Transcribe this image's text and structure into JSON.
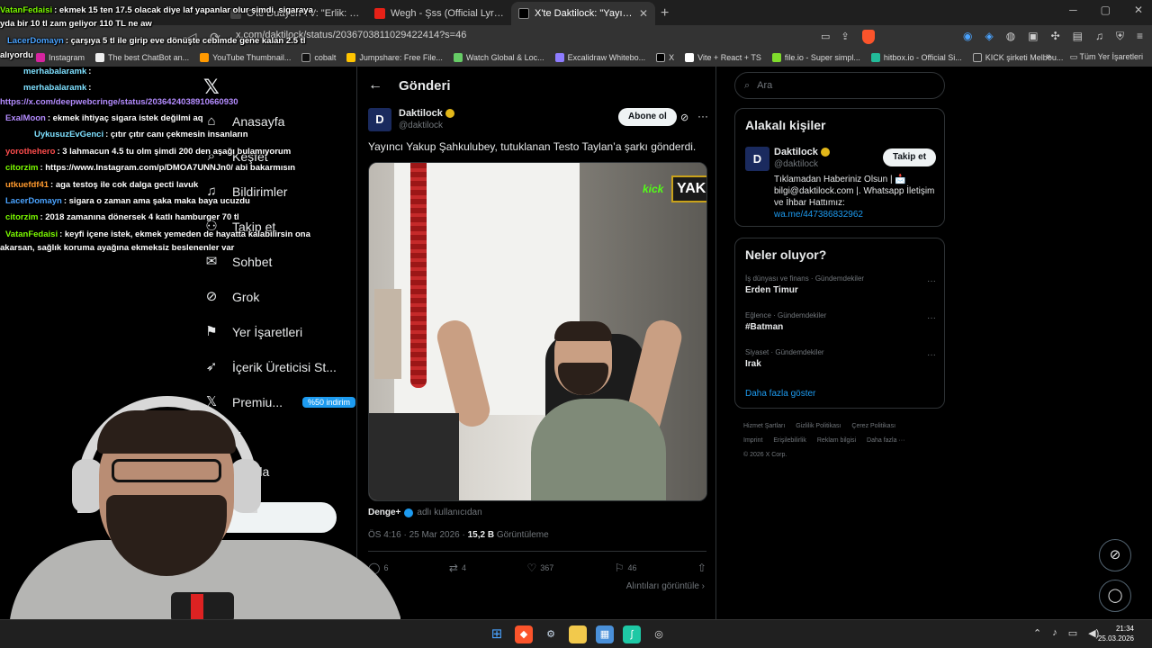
{
  "browser": {
    "tabs": [
      {
        "label": "C'te Duayen TV: \"Erlik: Nevruz'da TÜ",
        "active": false
      },
      {
        "label": "Wegh - Şss (Official Lyric Video) - Yo",
        "active": false
      },
      {
        "label": "X'te Daktilock: \"Yayıncı Yakup",
        "active": true
      }
    ],
    "url": "x.com/daktilock/status/2036703811029422414?s=46",
    "bookmarks": [
      "Instagram",
      "The best ChatBot an...",
      "YouTube Thumbnail...",
      "cobalt",
      "Jumpshare: Free File...",
      "Watch Global & Loc...",
      "Excalidraw Whitebo...",
      "X",
      "Vite + React + TS",
      "file.io - Super simpl...",
      "hitbox.io - Official Si...",
      "KICK şirketi Melbou..."
    ],
    "bookmarks_all": "Tüm Yer İşaretleri"
  },
  "x": {
    "nav": [
      {
        "label": "Anasayfa",
        "icon": "home-icon"
      },
      {
        "label": "Keşfet",
        "icon": "search-icon"
      },
      {
        "label": "Bildirimler",
        "icon": "bell-icon"
      },
      {
        "label": "Takip et",
        "icon": "follow-icon"
      },
      {
        "label": "Sohbet",
        "icon": "chat-icon"
      },
      {
        "label": "Grok",
        "icon": "grok-icon"
      },
      {
        "label": "Yer İşaretleri",
        "icon": "bookmark-icon"
      },
      {
        "label": "İçerik Üreticisi St...",
        "icon": "rocket-icon"
      },
      {
        "label": "Premiu...",
        "icon": "premium-icon"
      },
      {
        "label": "fil",
        "icon": "profile-icon"
      },
      {
        "label": "a fazla",
        "icon": "more-icon"
      }
    ],
    "premium_badge": "%50 indirim",
    "main_title": "Gönderi",
    "post": {
      "author_name": "Daktilock",
      "author_handle": "@daktilock",
      "avatar_letter": "D",
      "subscribe": "Abone ol",
      "text": "Yayıncı Yakup Şahkulubey, tutuklanan Testo Taylan’a şarkı gönderdi.",
      "kick_label": "kick",
      "kick_box": "YAK",
      "source_name": "Denge+",
      "source_sub": "adlı kullanıcıdan",
      "time": "ÖS 4:16 · 25 Mar 2026 ·",
      "views": "15,2 B",
      "views_label": "Görüntüleme",
      "replies": "6",
      "reposts": "4",
      "likes": "367",
      "bookmarks": "46",
      "quotes": "Alıntıları görüntüle ›"
    },
    "search_placeholder": "Ara",
    "related": {
      "title": "Alakalı kişiler",
      "name": "Daktilock",
      "handle": "@daktilock",
      "follow": "Takip et",
      "bio": "Tıklamadan Haberiniz Olsun | 📩 bilgi@daktilock.com |. Whatsapp İletişim ve İhbar Hattımız:",
      "link": "wa.me/447386832962"
    },
    "trends": {
      "title": "Neler oluyor?",
      "items": [
        {
          "category": "İş dünyası ve finans · Gündemdekiler",
          "name": "Erden Timur"
        },
        {
          "category": "Eğlence · Gündemdekiler",
          "name": "#Batman"
        },
        {
          "category": "Siyaset · Gündemdekiler",
          "name": "Irak"
        }
      ],
      "show_more": "Daha fazla göster"
    },
    "footer": [
      "Hizmet Şartları",
      "Gizlilik Politikası",
      "Çerez Politikası",
      "Imprint",
      "Erişilebilirlik",
      "Reklam bilgisi",
      "Daha fazla ···",
      "© 2026 X Corp."
    ]
  },
  "chat": [
    {
      "user": "VatanFedaisi",
      "color": "#7cfc00",
      "msg": ": ekmek 15 ten 17.5 olacak diye laf yapanlar olur şimdi, sigaraya"
    },
    {
      "user": "",
      "color": "#ffffff",
      "msg": "yda bir 10 tl zam geliyor 110 TL ne aw"
    },
    {
      "user": "LacerDomayn",
      "color": "#4aa3ff",
      "msg": ": çarşıya 5 tl ile girip eve dönüşte cebimde gene kalan 2.5 tl"
    },
    {
      "user": "",
      "color": "#ffffff",
      "msg": "alıyordu"
    },
    {
      "user": "merhabalaramk",
      "color": "#7ee0ff",
      "msg": ":"
    },
    {
      "user": "merhabalaramk",
      "color": "#7ee0ff",
      "msg": ":"
    },
    {
      "user": "",
      "color": "#b48cff",
      "msg": "https://x.com/deepwebcringe/status/2036424038910660930"
    },
    {
      "user": "ExalMoon",
      "color": "#b48cff",
      "msg": ": ekmek ihtiyaç sigara istek değilmi aq"
    },
    {
      "user": "UykusuzEvGenci",
      "color": "#7ee0ff",
      "msg": ": çıtır çıtır canı çekmesin insanların"
    },
    {
      "user": "yorothehero",
      "color": "#ff4d4d",
      "msg": ": 3 lahmacun 4.5 tu olm şimdi 200 den aşağı bulamıyorum"
    },
    {
      "user": "citorzim",
      "color": "#7cfc00",
      "msg": ": https://www.Instagram.com/p/DMOA7UNNJn0/ abi bakarmısın"
    },
    {
      "user": "utkuefdf41",
      "color": "#ff9a2e",
      "msg": ": aga testoş ile cok dalga gecti lavuk"
    },
    {
      "user": "LacerDomayn",
      "color": "#4aa3ff",
      "msg": ": sigara o zaman ama şaka maka baya ucuzdu"
    },
    {
      "user": "citorzim",
      "color": "#7cfc00",
      "msg": ": 2018 zamanına dönersek 4 katlı hamburger 70 tl"
    },
    {
      "user": "VatanFedaisi",
      "color": "#7cfc00",
      "msg": ": keyfi içene istek, ekmek yemeden de hayatta kalabilirsin ona"
    },
    {
      "user": "",
      "color": "#ffffff",
      "msg": "akarsan, sağlık koruma ayağına ekmeksiz beslenenler var"
    }
  ],
  "taskbar": {
    "time": "21:34",
    "date": "25.03.2026"
  }
}
